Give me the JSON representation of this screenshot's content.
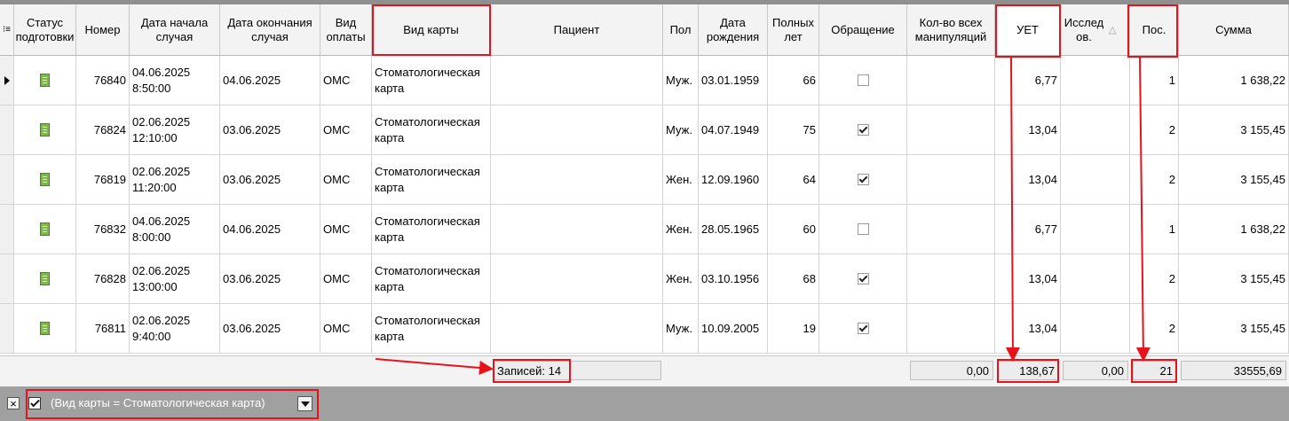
{
  "columns": {
    "status": "Статус подготовки",
    "number": "Номер",
    "start": "Дата начала случая",
    "end": "Дата окончания случая",
    "payment": "Вид оплаты",
    "card_type": "Вид карты",
    "patient": "Пациент",
    "sex": "Пол",
    "birth": "Дата рождения",
    "age": "Полных лет",
    "appeal": "Обращение",
    "manip": "Кол-во всех манипуляций",
    "uet": "УЕТ",
    "research": "Исслед ов.",
    "visits": "Пос.",
    "sum": "Сумма"
  },
  "sort_icon": "sort-ascending-triangle",
  "rows": [
    {
      "number": "76840",
      "start_date": "04.06.2025",
      "start_time": "8:50:00",
      "end": "04.06.2025",
      "payment": "ОМС",
      "card_type": "Стоматологическая карта",
      "patient": "",
      "sex": "Муж.",
      "birth": "03.01.1959",
      "age": "66",
      "appeal": false,
      "manip": "",
      "uet": "6,77",
      "research": "",
      "visits": "1",
      "sum": "1 638,22",
      "current": true
    },
    {
      "number": "76824",
      "start_date": "02.06.2025",
      "start_time": "12:10:00",
      "end": "03.06.2025",
      "payment": "ОМС",
      "card_type": "Стоматологическая карта",
      "patient": "",
      "sex": "Муж.",
      "birth": "04.07.1949",
      "age": "75",
      "appeal": true,
      "manip": "",
      "uet": "13,04",
      "research": "",
      "visits": "2",
      "sum": "3 155,45",
      "current": false
    },
    {
      "number": "76819",
      "start_date": "02.06.2025",
      "start_time": "11:20:00",
      "end": "03.06.2025",
      "payment": "ОМС",
      "card_type": "Стоматологическая карта",
      "patient": "",
      "sex": "Жен.",
      "birth": "12.09.1960",
      "age": "64",
      "appeal": true,
      "manip": "",
      "uet": "13,04",
      "research": "",
      "visits": "2",
      "sum": "3 155,45",
      "current": false
    },
    {
      "number": "76832",
      "start_date": "04.06.2025",
      "start_time": "8:00:00",
      "end": "04.06.2025",
      "payment": "ОМС",
      "card_type": "Стоматологическая карта",
      "patient": "",
      "sex": "Жен.",
      "birth": "28.05.1965",
      "age": "60",
      "appeal": false,
      "manip": "",
      "uet": "6,77",
      "research": "",
      "visits": "1",
      "sum": "1 638,22",
      "current": false
    },
    {
      "number": "76828",
      "start_date": "02.06.2025",
      "start_time": "13:00:00",
      "end": "03.06.2025",
      "payment": "ОМС",
      "card_type": "Стоматологическая карта",
      "patient": "",
      "sex": "Жен.",
      "birth": "03.10.1956",
      "age": "68",
      "appeal": true,
      "manip": "",
      "uet": "13,04",
      "research": "",
      "visits": "2",
      "sum": "3 155,45",
      "current": false
    },
    {
      "number": "76811",
      "start_date": "02.06.2025",
      "start_time": "9:40:00",
      "end": "03.06.2025",
      "payment": "ОМС",
      "card_type": "Стоматологическая карта",
      "patient": "",
      "sex": "Муж.",
      "birth": "10.09.2005",
      "age": "19",
      "appeal": true,
      "manip": "",
      "uet": "13,04",
      "research": "",
      "visits": "2",
      "sum": "3 155,45",
      "current": false
    }
  ],
  "footer": {
    "records": "Записей: 14",
    "manip_total": "0,00",
    "uet_total": "138,67",
    "research_total": "0,00",
    "visits_total": "21",
    "sum_total": "33555,69"
  },
  "filter": {
    "text": "(Вид карты = Стоматологическая карта)",
    "enabled": true
  },
  "colors": {
    "highlight": "#e8131a",
    "filter_bar": "#a0a0a0",
    "header_bg": "#f3f3f3"
  }
}
